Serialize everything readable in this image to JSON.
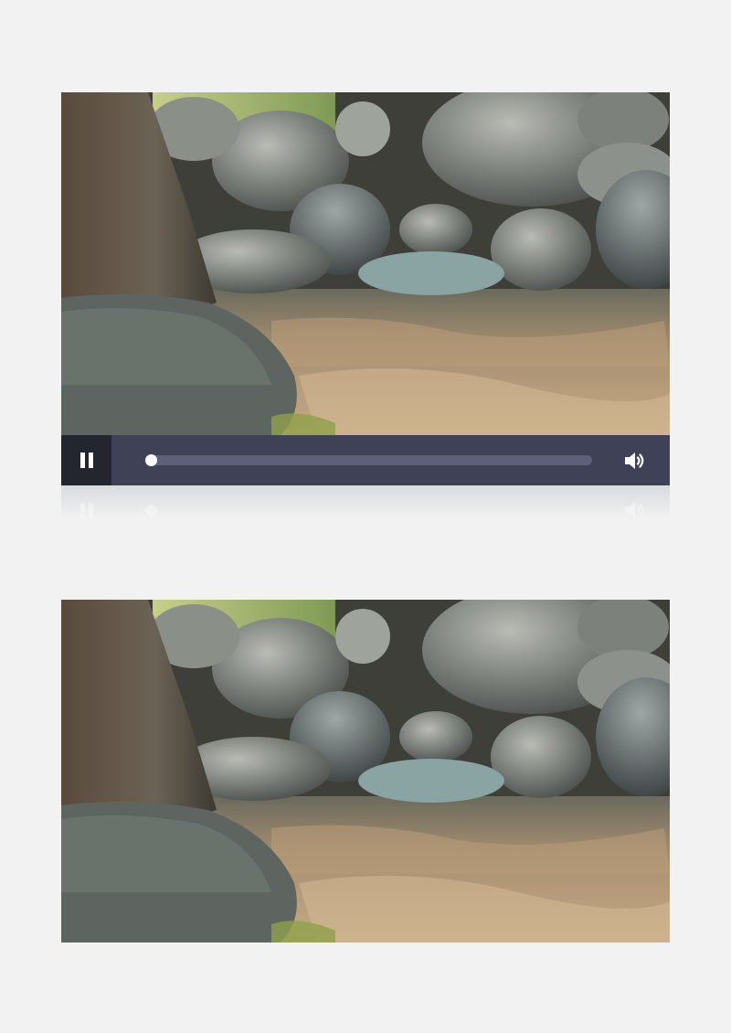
{
  "scene": {
    "description_icon": "river-rocks-video-frame",
    "colors": {
      "page_background": "#f2f2f2",
      "control_bar": "#3f4257",
      "pause_button_bg": "#23252f",
      "track": "#5d6078",
      "knob": "#ffffff"
    }
  },
  "player": {
    "state": "playing",
    "pause_icon": "pause-icon",
    "volume_icon": "volume-icon",
    "progress": 0.0
  }
}
